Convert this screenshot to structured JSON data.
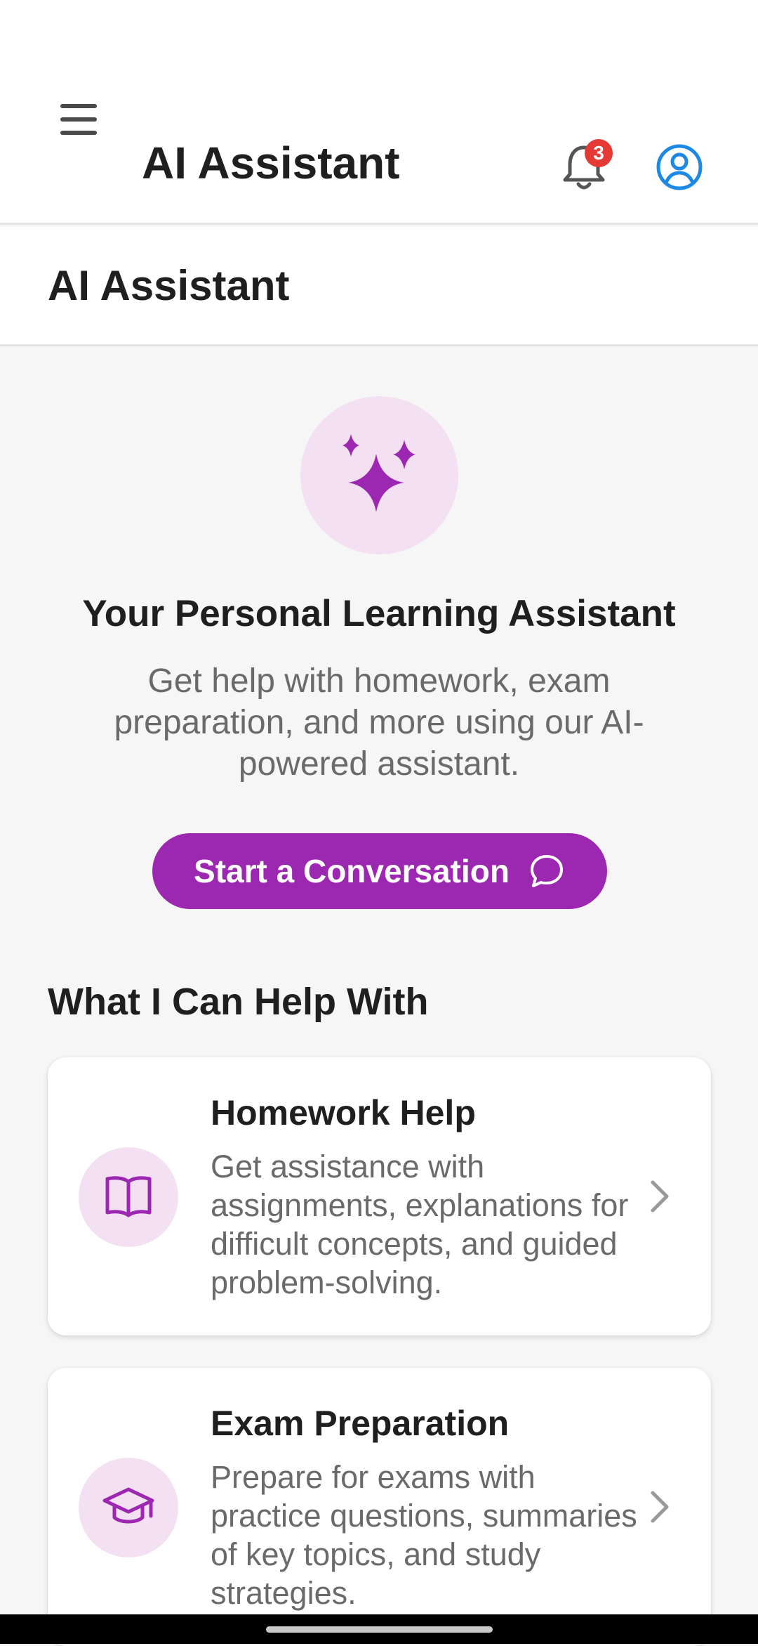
{
  "app_bar": {
    "title": "AI Assistant",
    "notification_count": "3",
    "icons": [
      "menu-icon",
      "bell-icon",
      "account-circle-icon"
    ]
  },
  "page": {
    "title": "AI Assistant"
  },
  "hero": {
    "icon": "sparkles-icon",
    "title": "Your Personal Learning Assistant",
    "subtitle": "Get help with homework, exam preparation, and more using our AI-powered assistant.",
    "cta_label": "Start a Conversation",
    "cta_icon": "chat-bubble-icon"
  },
  "section": {
    "title": "What I Can Help With"
  },
  "cards": [
    {
      "title": "Homework Help",
      "description": "Get assistance with assignments, explanations for difficult concepts, and guided problem-solving.",
      "icon": "book-open-icon"
    },
    {
      "title": "Exam Preparation",
      "description": "Prepare for exams with practice questions, summaries of key topics, and study strategies.",
      "icon": "graduation-cap-icon"
    }
  ],
  "colors": {
    "accent": "#9c27b0",
    "accent_light": "#f3e1f3",
    "badge": "#e53935",
    "account": "#1e88e5"
  }
}
